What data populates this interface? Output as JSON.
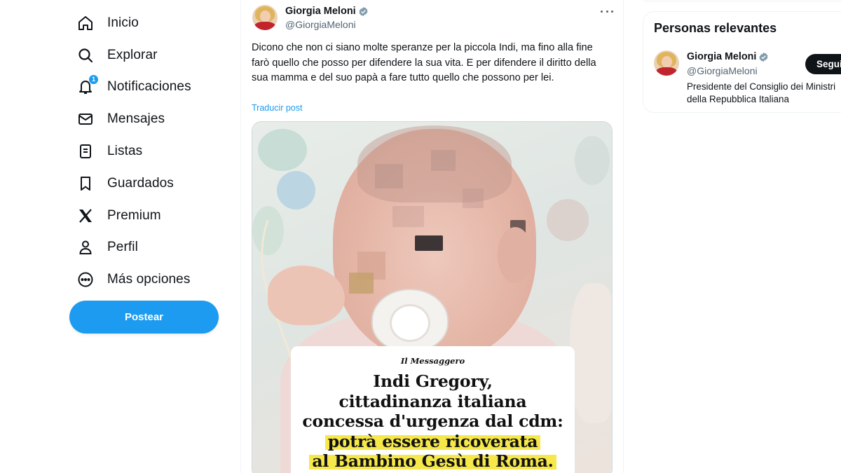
{
  "sidebar": {
    "items": [
      {
        "label": "Inicio",
        "icon": "home-icon"
      },
      {
        "label": "Explorar",
        "icon": "search-icon"
      },
      {
        "label": "Notificaciones",
        "icon": "bell-icon",
        "badge": "1"
      },
      {
        "label": "Mensajes",
        "icon": "mail-icon"
      },
      {
        "label": "Listas",
        "icon": "list-icon"
      },
      {
        "label": "Guardados",
        "icon": "bookmark-icon"
      },
      {
        "label": "Premium",
        "icon": "x-logo-icon"
      },
      {
        "label": "Perfil",
        "icon": "person-icon"
      },
      {
        "label": "Más opciones",
        "icon": "more-circle-icon"
      }
    ],
    "post_button": "Postear"
  },
  "tweet": {
    "author_name": "Giorgia Meloni",
    "author_handle": "@GiorgiaMeloni",
    "text": "Dicono che non ci siano molte speranze per la piccola Indi, ma fino alla fine farò quello che posso per difendere la sua vita. E per difendere il diritto della sua mamma e del suo papà a fare tutto quello che possono per lei.",
    "translate_link": "Traducir post",
    "media": {
      "masthead": "Il Messaggero",
      "headline_lines": [
        "Indi Gregory,",
        "cittadinanza italiana",
        "concessa d'urgenza dal cdm:",
        "potrà essere ricoverata",
        "al Bambino Gesù di Roma."
      ]
    }
  },
  "right_panel": {
    "title": "Personas relevantes",
    "person": {
      "name": "Giorgia Meloni",
      "handle": "@GiorgiaMeloni",
      "follow_label": "Seguir",
      "bio": "Presidente del Consiglio dei Ministri\ndella Repubblica Italiana"
    }
  },
  "colors": {
    "accent": "#1d9bf0",
    "text": "#0f1419",
    "muted": "#536471",
    "highlight": "#f6e84a"
  }
}
